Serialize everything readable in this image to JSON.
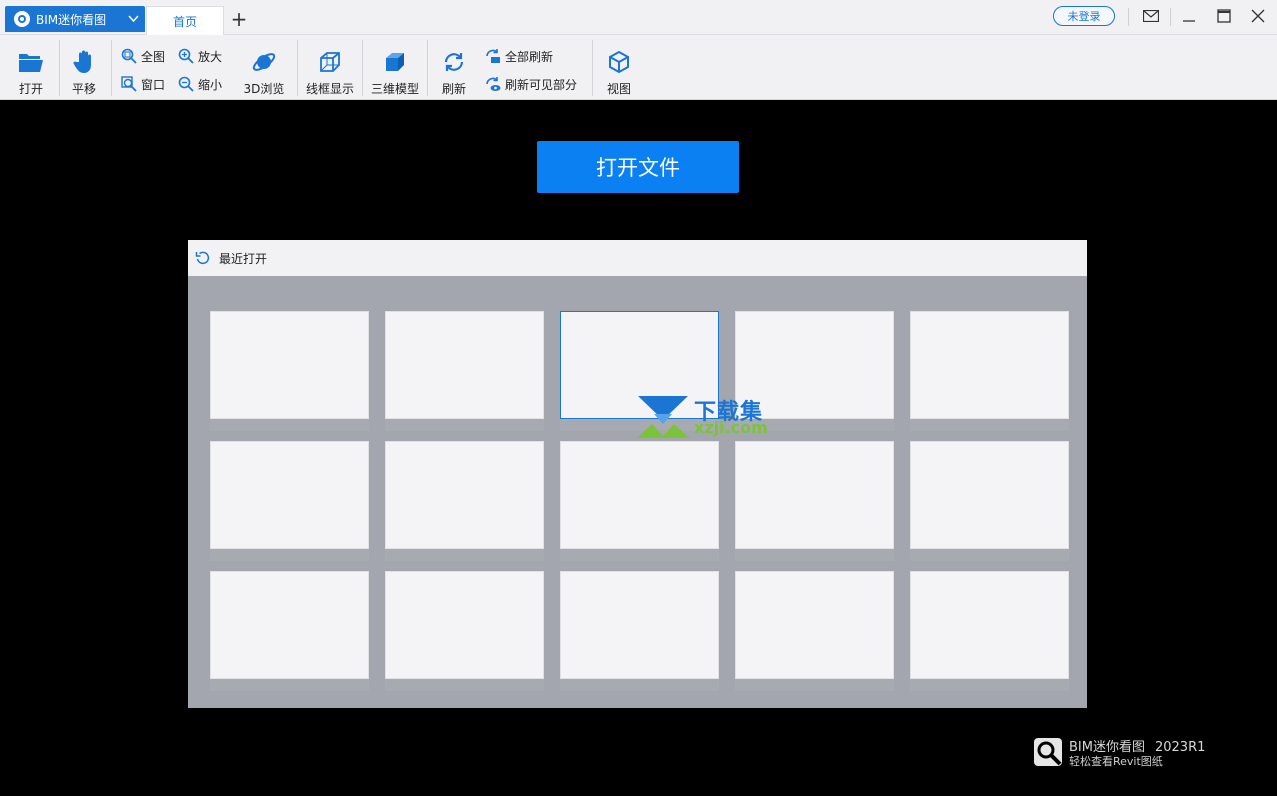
{
  "titlebar": {
    "app_name": "BIM迷你看图",
    "tabs": [
      {
        "label": "首页"
      }
    ],
    "add_tab": "+",
    "login": "未登录"
  },
  "toolbar": {
    "open": "打开",
    "pan": "平移",
    "fit_all": "全图",
    "window": "窗口",
    "zoom_in": "放大",
    "zoom_out": "缩小",
    "browse_3d": "3D浏览",
    "wireframe": "线框显示",
    "model_3d": "三维模型",
    "refresh": "刷新",
    "refresh_all": "全部刷新",
    "refresh_visible": "刷新可见部分",
    "view": "视图"
  },
  "main": {
    "open_file_button": "打开文件",
    "recent": {
      "title": "最近打开",
      "thumbnails": 15,
      "selected_index": 2
    }
  },
  "watermark": {
    "text": "下载集",
    "sub": "xzji.com"
  },
  "brand": {
    "name": "BIM迷你看图",
    "version": "2023R1",
    "tagline": "轻松查看Revit图纸"
  },
  "colors": {
    "accent": "#1a76d2",
    "open_button": "#0a80f3",
    "background": "#000000",
    "panel": "#a4a6af"
  }
}
